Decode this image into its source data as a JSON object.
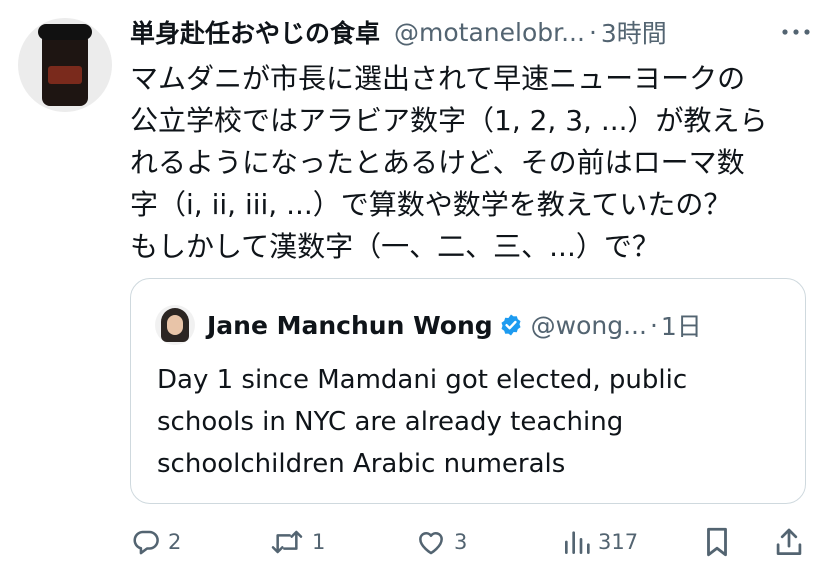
{
  "post": {
    "author_name": "単身赴任おやじの食卓",
    "handle": "@motanelobr...",
    "separator": "·",
    "time": "3時間",
    "text_lines": [
      "マムダニが市長に選出されて早速ニューヨークの",
      "公立学校ではアラビア数字（1, 2, 3, ...）が教えら",
      "れるようになったとあるけど、その前はローマ数",
      "字（i, ii, iii, ...）で算数や数学を教えていたの？",
      "もしかして漢数字（一、二、三、...）で？"
    ]
  },
  "quote": {
    "author_name": "Jane Manchun Wong",
    "handle": "@wong...",
    "separator": "·",
    "time": "1日",
    "text_lines": [
      "Day 1 since Mamdani got elected, public",
      "schools in NYC are already teaching",
      "schoolchildren Arabic numerals"
    ]
  },
  "actions": {
    "replies": "2",
    "reposts": "1",
    "likes": "3",
    "views": "317"
  },
  "icons": {
    "more": "more-icon",
    "verified": "verified-badge-icon",
    "reply": "reply-icon",
    "repost": "repost-icon",
    "like": "heart-icon",
    "views": "views-icon",
    "bookmark": "bookmark-icon",
    "share": "share-icon"
  },
  "colors": {
    "text": "#0f1419",
    "secondary": "#536471",
    "verified": "#1d9bf0",
    "border": "#cfd9de"
  }
}
